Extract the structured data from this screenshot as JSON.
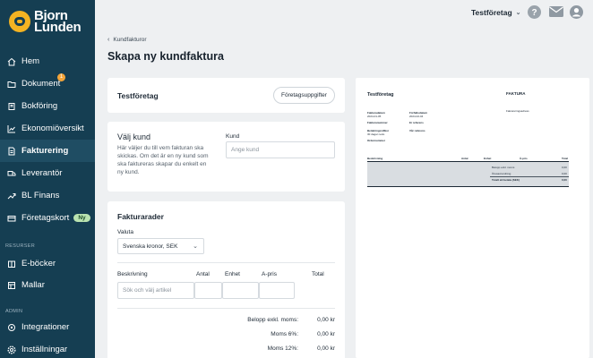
{
  "brand": {
    "line1": "Bjorn",
    "line2": "Lunden"
  },
  "sidebar": {
    "items": [
      {
        "label": "Hem",
        "icon": "home-icon"
      },
      {
        "label": "Dokument",
        "icon": "folder-icon",
        "badge": "1"
      },
      {
        "label": "Bokföring",
        "icon": "book-icon"
      },
      {
        "label": "Ekonomiöversikt",
        "icon": "chart-icon"
      },
      {
        "label": "Fakturering",
        "icon": "invoice-icon"
      },
      {
        "label": "Leverantör",
        "icon": "truck-icon"
      },
      {
        "label": "BL Finans",
        "icon": "trend-icon"
      },
      {
        "label": "Företagskort",
        "icon": "card-icon",
        "badge": "Ny"
      }
    ],
    "resources_heading": "RESURSER",
    "resources": [
      {
        "label": "E-böcker",
        "icon": "ebook-icon"
      },
      {
        "label": "Mallar",
        "icon": "template-icon"
      }
    ],
    "admin_heading": "ADMIN",
    "admin": [
      {
        "label": "Integrationer",
        "icon": "integration-icon"
      },
      {
        "label": "Inställningar",
        "icon": "settings-icon"
      }
    ]
  },
  "header": {
    "company": "Testföretag"
  },
  "breadcrumb": {
    "label": "Kundfakturor"
  },
  "page": {
    "title": "Skapa ny kundfaktura"
  },
  "company_card": {
    "name": "Testföretag",
    "button": "Företagsuppgifter"
  },
  "customer_card": {
    "title": "Välj kund",
    "help": [
      "Här väljer du till vem fakturan ska",
      "skickas. Om det är en ny kund som",
      "ska faktureras skapar du enkelt en",
      "ny kund."
    ],
    "field_label": "Kund",
    "field_placeholder": "Ange kund"
  },
  "rows_card": {
    "title": "Fakturarader",
    "currency_label": "Valuta",
    "currency_value": "Svenska kronor, SEK",
    "columns": [
      "Beskrivning",
      "Antal",
      "Enhet",
      "A-pris",
      "Total"
    ],
    "article_placeholder": "Sök och välj artikel",
    "summary": [
      {
        "label": "Belopp exkl. moms:",
        "value": "0,00 kr"
      },
      {
        "label": "Moms 6%:",
        "value": "0,00 kr"
      },
      {
        "label": "Moms 12%:",
        "value": "0,00 kr"
      }
    ]
  },
  "preview": {
    "company": "Testföretag",
    "doc_title": "FAKTURA",
    "billing_address_label": "Faktureringsadress",
    "meta_col1": [
      {
        "label": "Fakturadatum",
        "value": "2024-01-05"
      },
      {
        "label": "Fakturanummer",
        "value": ""
      },
      {
        "label": "Betalningsvillkor",
        "value": "30 dagar netto"
      },
      {
        "label": "Ordernummer",
        "value": ""
      }
    ],
    "meta_col2": [
      {
        "label": "Förfallodatum",
        "value": "2024-02-04"
      },
      {
        "label": "Er referens",
        "value": ""
      },
      {
        "label": "Vår referens",
        "value": ""
      }
    ],
    "columns": [
      "Beskrivning",
      "Antal",
      "Enhet",
      "À-pris",
      "Total"
    ],
    "totals": [
      {
        "label": "Belopp exkl. moms",
        "value": "0,00"
      },
      {
        "label": "Öresavrundning",
        "value": "0,00"
      },
      {
        "label": "Totalt att betala (SEK)",
        "value": "0,00"
      }
    ]
  },
  "colors": {
    "sidebar": "#153e52",
    "accent": "#f4b322",
    "page_bg": "#eef0f2"
  }
}
